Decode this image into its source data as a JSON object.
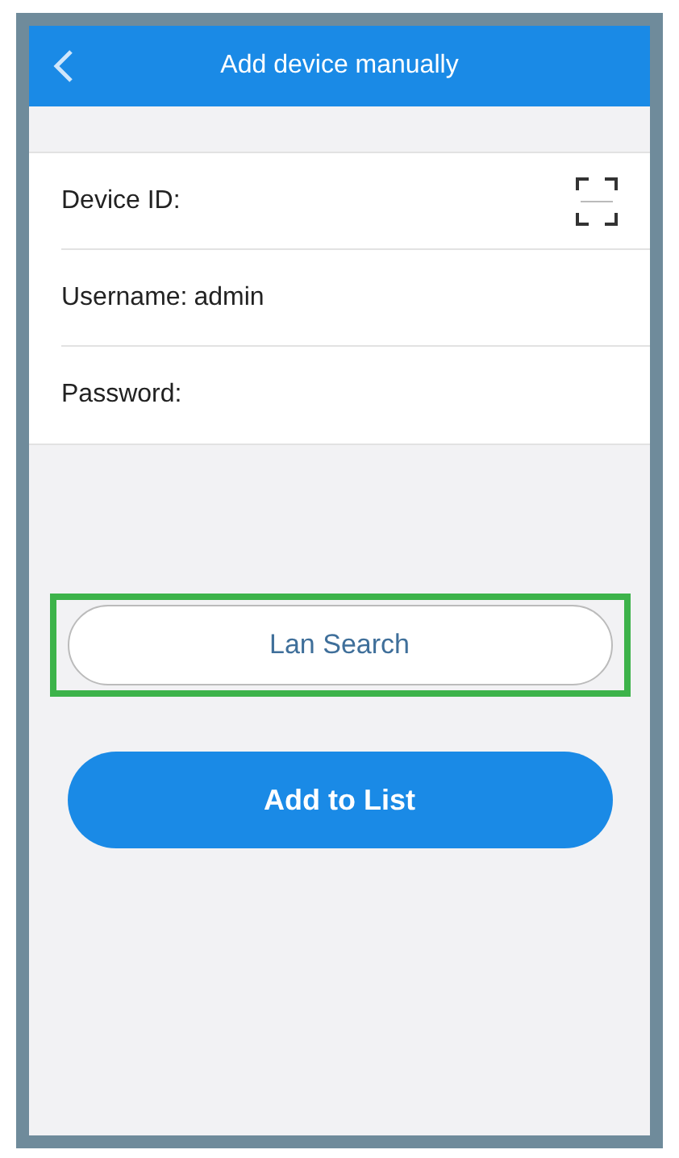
{
  "header": {
    "title": "Add device manually"
  },
  "form": {
    "fields": [
      {
        "label": "Device ID:",
        "kind": "scan"
      },
      {
        "label": "Username:",
        "value": "admin",
        "kind": "text"
      },
      {
        "label": "Password:",
        "kind": "text"
      }
    ]
  },
  "buttons": [
    {
      "label": "Lan Search",
      "kind": "outline",
      "highlighted": true
    },
    {
      "label": "Add to List",
      "kind": "primary",
      "highlighted": false
    }
  ]
}
